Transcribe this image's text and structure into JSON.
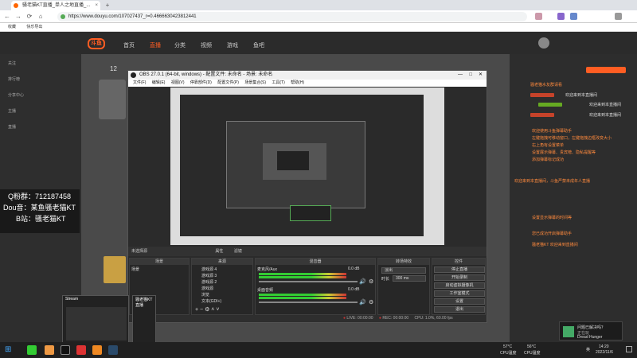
{
  "browser": {
    "tab_title": "骚老猫KT直播_单人之地直播_...",
    "tab_close": "×",
    "new_tab": "+",
    "url": "https://www.douyu.com/107027437_r=0.4666630423812441",
    "bookmarks": [
      "收藏",
      "快乐导出"
    ],
    "nav": {
      "back": "←",
      "forward": "→",
      "reload": "⟳",
      "home": "⌂"
    }
  },
  "douyu": {
    "logo": "斗鱼",
    "nav_items": [
      "首页",
      "直播",
      "分类",
      "视频",
      "游戏",
      "鱼吧"
    ],
    "sidebar_items": [
      "关注",
      "排行榜",
      "分享中心",
      "主播",
      "直播"
    ],
    "overlay_lines": [
      "Q粉群：712187458",
      "Dou音：某鱼骚老猫KT",
      "B站：骚老猫KT"
    ],
    "room_number": "12",
    "chat_lines": [
      "骚老猫水友群请看",
      "欢迎来到本直播间",
      "欢迎来到本直播间",
      "欢迎来到本直播间",
      "欢迎使用斗鱼弹幕助手",
      "左键拖拽可移动窗口，左键拖拽边框改变大小",
      "右上角有设置菜单",
      "设置展示弹幕、贵宾榜、隐私提醒等",
      "添加弹幕标记成功",
      "欢迎来到本直播间，斗鱼严禁未成年人直播",
      "设置显示弹幕的时间等",
      "您已成功开启弹幕助手",
      "骚老猫KT 欢迎来到直播间"
    ],
    "colors": {
      "brand": "#ff5d23",
      "chat_highlight": "#ff8a3d"
    }
  },
  "obs": {
    "title": "OBS 27.0.1 (64-bit, windows) - 配置文件: 未命名 - 场景: 未命名",
    "menu": [
      "文件(F)",
      "编辑(E)",
      "视图(V)",
      "停靠部件(D)",
      "配置文件(P)",
      "场景集合(S)",
      "工具(T)",
      "帮助(H)"
    ],
    "scene_bar": {
      "label": "未选择源",
      "properties": "属性",
      "filters": "滤镜"
    },
    "docks": {
      "scenes": {
        "title": "场景",
        "items": [
          "场景"
        ]
      },
      "sources": {
        "title": "来源",
        "items": [
          "游戏源 4",
          "游戏源 3",
          "游戏源 2",
          "游戏源",
          "浏览",
          "文本(GDI+)"
        ]
      },
      "mixer": {
        "title": "混音器",
        "ch1": "桌面音频",
        "ch1_db": "0.0 dB",
        "ch2": "麦克风/Aux",
        "ch2_db": "0.0 dB"
      },
      "transitions": {
        "title": "转场特效",
        "type": "淡出",
        "duration_label": "时长",
        "duration": "300 ms"
      },
      "controls": {
        "title": "控件",
        "buttons": [
          "停止直播",
          "开始录制",
          "启动虚拟摄像机",
          "工作室模式",
          "设置",
          "退出"
        ]
      }
    },
    "status": {
      "live": "LIVE: 00:00:00",
      "rec": "REC: 00:00:00",
      "cpu": "CPU: 1.0%, 60.00 fps"
    }
  },
  "thumbnails": [
    "Stream",
    "骚老猫KT直播"
  ],
  "taskbar": {
    "cpu_temp_1": "57°C",
    "cpu_label_1": "CPU温度",
    "cpu_temp_2": "56°C",
    "cpu_label_2": "CPU温度",
    "time": "14:20",
    "date": "2022/11/6",
    "lang": "英",
    "toast_line1": "问题已解决吗？",
    "toast_line2": "正在玩",
    "toast_line3": "Dread Hunger"
  }
}
